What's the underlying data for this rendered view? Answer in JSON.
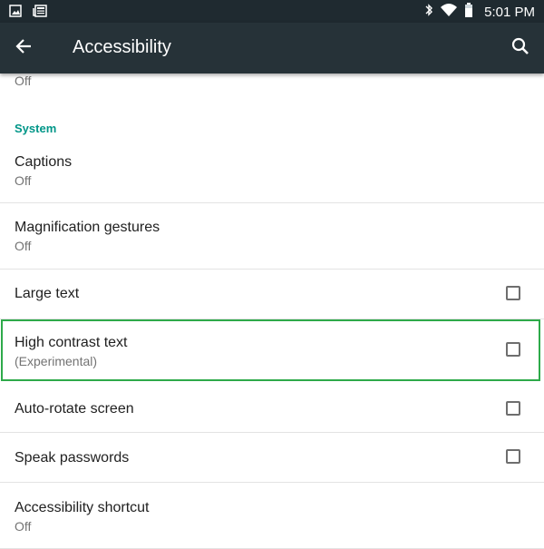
{
  "status_bar": {
    "time": "5:01 PM",
    "left_icons": [
      "image-icon",
      "news-icon"
    ],
    "right_icons": [
      "bluetooth-icon",
      "wifi-icon",
      "battery-icon"
    ]
  },
  "app_bar": {
    "title": "Accessibility",
    "back_icon": "back-arrow-icon",
    "search_icon": "search-icon"
  },
  "list": {
    "top_partial_subtitle": "Off",
    "section_header": "System",
    "items": [
      {
        "title": "Captions",
        "subtitle": "Off",
        "checkbox": false
      },
      {
        "title": "Magnification gestures",
        "subtitle": "Off",
        "checkbox": false
      },
      {
        "title": "Large text",
        "subtitle": "",
        "checkbox": true,
        "checked": false
      },
      {
        "title": "High contrast text",
        "subtitle": "(Experimental)",
        "checkbox": true,
        "checked": false
      },
      {
        "title": "Auto-rotate screen",
        "subtitle": "",
        "checkbox": true,
        "checked": false
      },
      {
        "title": "Speak passwords",
        "subtitle": "",
        "checkbox": true,
        "checked": false
      },
      {
        "title": "Accessibility shortcut",
        "subtitle": "Off",
        "checkbox": false
      }
    ]
  },
  "colors": {
    "status_bar": "#1f2a30",
    "app_bar": "#263238",
    "section_header": "#009688",
    "highlight_border": "#2eaa4a"
  }
}
